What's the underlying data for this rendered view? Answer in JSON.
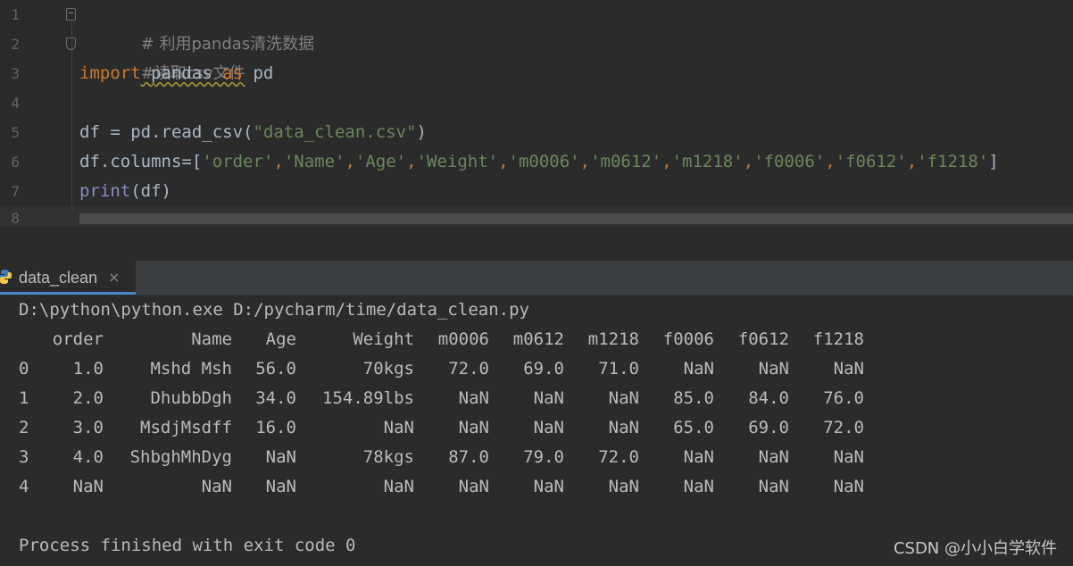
{
  "editor": {
    "line_numbers": [
      "1",
      "2",
      "3",
      "4",
      "5",
      "6",
      "7",
      "8"
    ],
    "line1_hash": "#",
    "line1_comment": " 利用pandas清洗数据",
    "line2_hash": "#",
    "line2_comment": "读取csv文件",
    "line3": {
      "kw_import": "import",
      "mod": " pandas ",
      "kw_as": "as",
      "alias": " pd"
    },
    "line5": {
      "prefix": "df = pd.read_csv(",
      "arg": "\"data_clean.csv\"",
      "suffix": ")"
    },
    "line6": {
      "prefix": "df.columns=[",
      "columns": [
        "'order'",
        "'Name'",
        "'Age'",
        "'Weight'",
        "'m0006'",
        "'m0612'",
        "'m1218'",
        "'f0006'",
        "'f0612'",
        "'f1218'"
      ],
      "separator": ",",
      "suffix": "]"
    },
    "line7": {
      "fn": "print",
      "args": "(df)"
    }
  },
  "run_panel": {
    "tab_label": "data_clean",
    "tab_close": "×",
    "command": "D:\\python\\python.exe D:/pycharm/time/data_clean.py",
    "table": {
      "headers": [
        "order",
        "Name",
        "Age",
        "Weight",
        "m0006",
        "m0612",
        "m1218",
        "f0006",
        "f0612",
        "f1218"
      ],
      "rows": [
        {
          "index": "0",
          "cells": [
            "1.0",
            "Mshd Msh",
            "56.0",
            "70kgs",
            "72.0",
            "69.0",
            "71.0",
            "NaN",
            "NaN",
            "NaN"
          ]
        },
        {
          "index": "1",
          "cells": [
            "2.0",
            "DhubbDgh",
            "34.0",
            "154.89lbs",
            "NaN",
            "NaN",
            "NaN",
            "85.0",
            "84.0",
            "76.0"
          ]
        },
        {
          "index": "2",
          "cells": [
            "3.0",
            "MsdjMsdff",
            "16.0",
            "NaN",
            "NaN",
            "NaN",
            "NaN",
            "65.0",
            "69.0",
            "72.0"
          ]
        },
        {
          "index": "3",
          "cells": [
            "4.0",
            "ShbghMhDyg",
            "NaN",
            "78kgs",
            "87.0",
            "79.0",
            "72.0",
            "NaN",
            "NaN",
            "NaN"
          ]
        },
        {
          "index": "4",
          "cells": [
            "NaN",
            "NaN",
            "NaN",
            "NaN",
            "NaN",
            "NaN",
            "NaN",
            "NaN",
            "NaN",
            "NaN"
          ]
        }
      ]
    },
    "exit_message": "Process finished with exit code 0"
  },
  "watermark": "CSDN @小小白学软件",
  "colors": {
    "background": "#2b2b2b",
    "keyword": "#cc7832",
    "string": "#6a8759",
    "builtin": "#8888c6",
    "comment": "#808080",
    "console_text": "#bbbbbb"
  },
  "icons": {
    "tab_icon": "python-icon",
    "fold": "fold-marker-icon"
  }
}
